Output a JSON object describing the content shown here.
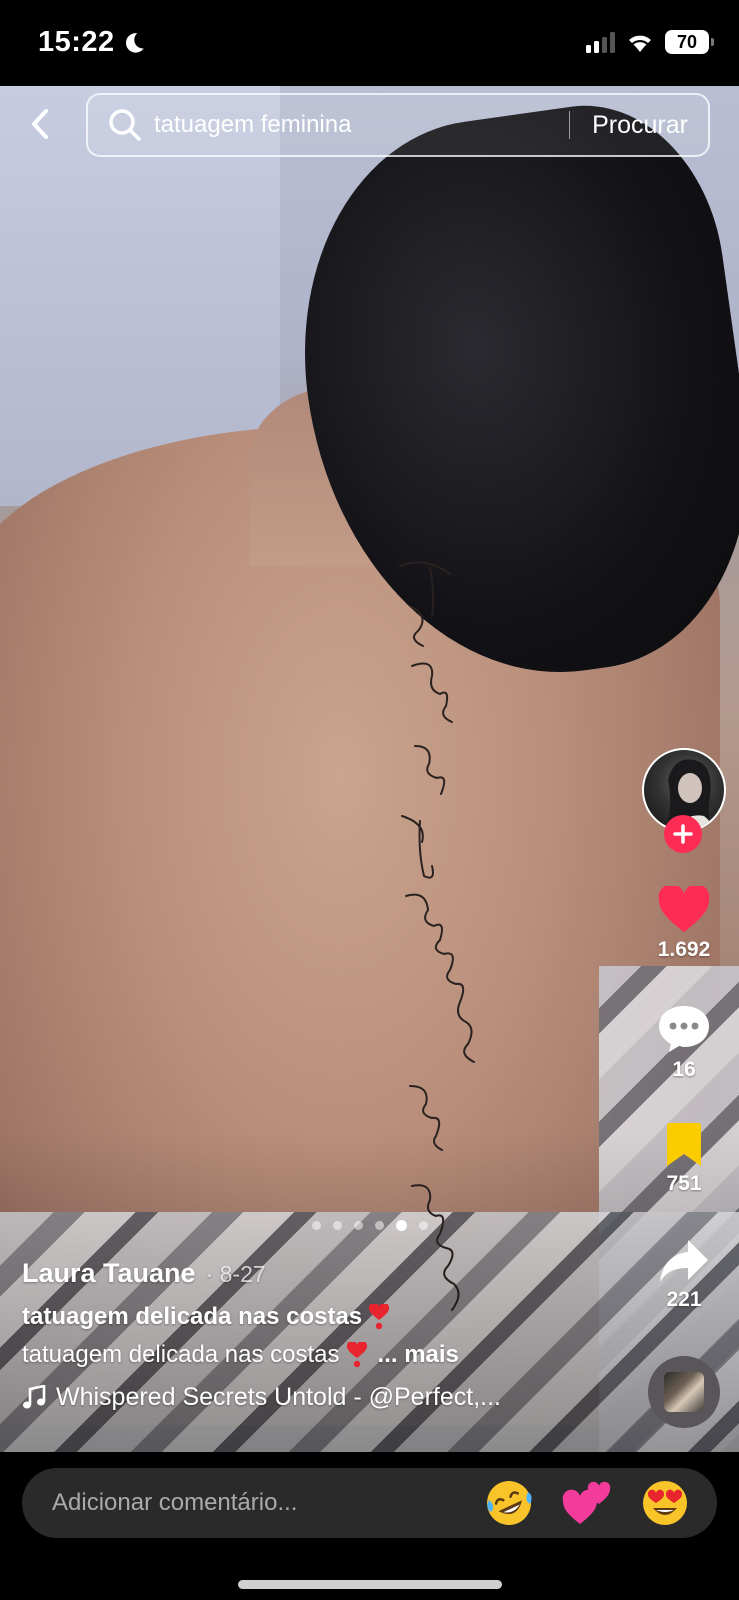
{
  "status_bar": {
    "time": "15:22",
    "battery": "70"
  },
  "search": {
    "query": "tatuagem feminina",
    "submit_label": "Procurar"
  },
  "video": {
    "tattoo_text": "Te amo em teu momento mais obscuro"
  },
  "rail": {
    "likes": "1.692",
    "comments": "16",
    "saves": "751",
    "shares": "221"
  },
  "pagination": {
    "total": 6,
    "active_index": 4
  },
  "post": {
    "author": "Laura Tauane",
    "date": "· 8-27",
    "title": "tatuagem delicada nas costas",
    "description": "tatuagem delicada nas costas",
    "more_label": "... mais",
    "music": "Whispered Secrets Untold - @Perfect,..."
  },
  "comment_bar": {
    "placeholder": "Adicionar comentário..."
  },
  "colors": {
    "accent": "#fe2c55",
    "like": "#fe2c55",
    "bookmark": "#facd00"
  }
}
